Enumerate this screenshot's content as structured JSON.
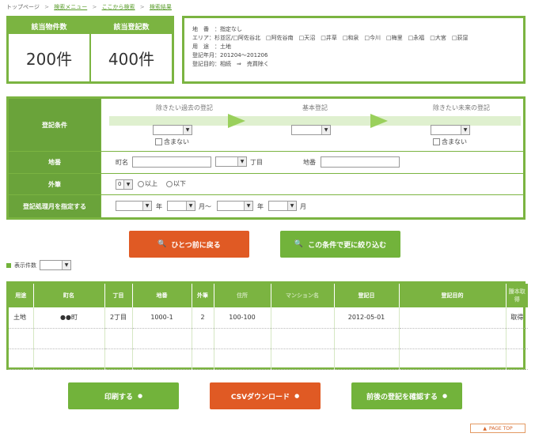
{
  "breadcrumb": {
    "top": "トップページ",
    "menu": "検索メニュー",
    "from": "ここから検索",
    "result": "検索結果",
    "sep": ">"
  },
  "counts": {
    "property_label": "該当物件数",
    "property_value": "200件",
    "registry_label": "該当登記数",
    "registry_value": "400件"
  },
  "conditions": {
    "line1": "地　番　：指定なし",
    "line2": "エリア：杉並区/□阿佐谷北　□阿佐谷南　□天沼　□井草　□和泉　□今川　□梅里　□永福　□大宮　□荻窪",
    "line3": "用　途　：土地",
    "line4": "登記年月：201204〜201206",
    "line5": "登記目的：相続　⇒　売買除く"
  },
  "form": {
    "registry_label": "登記条件",
    "past_head": "除きたい過去の登記",
    "base_head": "基本登記",
    "future_head": "除きたい未来の登記",
    "exclude_label": "含まない",
    "chiban_label": "地番",
    "town_label": "町名",
    "chome_label": "丁目",
    "lot_label": "地番",
    "gaihitsu_label": "外筆",
    "gaihitsu_value": "0",
    "above_label": "以上",
    "below_label": "以下",
    "period_label": "登記処理月を指定する",
    "year_label": "年",
    "month_label": "月〜",
    "year_label2": "年",
    "month_label2": "月"
  },
  "buttons": {
    "back": "ひとつ前に戻る",
    "refine": "この条件で更に絞り込む",
    "print": "印刷する",
    "csv": "CSVダウンロード",
    "around": "前後の登記を確認する",
    "pagetop": "PAGE TOP"
  },
  "perpage": {
    "label": "表示件数"
  },
  "table": {
    "headers": [
      "用途",
      "町名",
      "丁目",
      "地番",
      "外筆",
      "住所",
      "マンション名",
      "登記日",
      "登記目的",
      "謄本取得"
    ],
    "rows": [
      [
        "土地",
        "●●町",
        "2丁目",
        "1000-1",
        "2",
        "100-100",
        "",
        "2012-05-01",
        "",
        "取得"
      ]
    ]
  },
  "icons": {
    "search": "magnifier-icon",
    "circle_arrow": "circle-arrow-icon",
    "up_arrow": "up-arrow-icon"
  }
}
